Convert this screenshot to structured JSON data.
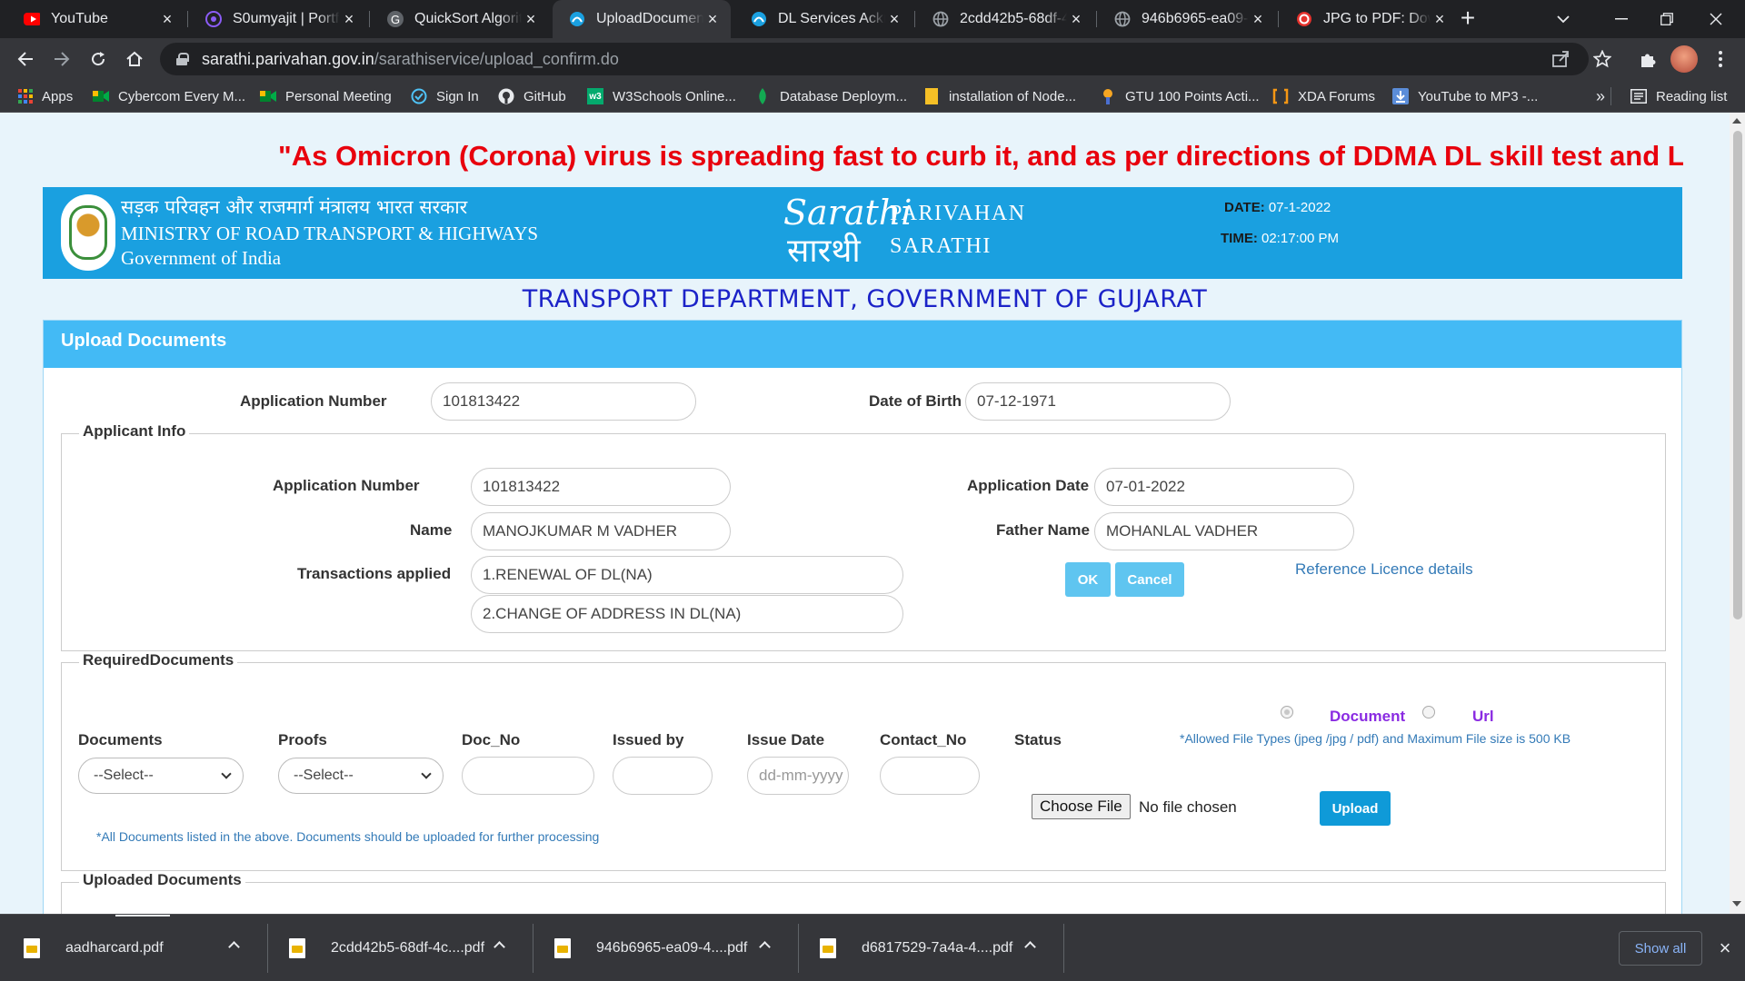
{
  "browser": {
    "tabs": [
      {
        "title": "YouTube",
        "icon": "youtube-icon",
        "color": "#ff0000"
      },
      {
        "title": "S0umyajit | Portfo",
        "icon": "portfolio-icon",
        "color": "#8b5cf6"
      },
      {
        "title": "QuickSort Algorit",
        "icon": "quicksort-icon",
        "color": "#5f6368"
      },
      {
        "title": "UploadDocument",
        "icon": "sarathi-icon",
        "color": "#1aa0e0"
      },
      {
        "title": "DL Services Ackn",
        "icon": "sarathi-icon",
        "color": "#1aa0e0"
      },
      {
        "title": "2cdd42b5-68df-4",
        "icon": "globe-icon",
        "color": "#9aa0a6"
      },
      {
        "title": "946b6965-ea09-4",
        "icon": "globe-icon",
        "color": "#9aa0a6"
      },
      {
        "title": "JPG to PDF: Down",
        "icon": "ilovepdf-icon",
        "color": "#e5322d"
      }
    ],
    "active_tab": 3,
    "url_host": "sarathi.parivahan.gov.in",
    "url_path": "/sarathiservice/upload_confirm.do",
    "bookmarks": [
      {
        "label": "Apps",
        "icon": "apps-grid-icon"
      },
      {
        "label": "Cybercom Every M...",
        "icon": "meet-icon"
      },
      {
        "label": "Personal Meeting",
        "icon": "meet-icon"
      },
      {
        "label": "Sign In",
        "icon": "signin-icon"
      },
      {
        "label": "GitHub",
        "icon": "github-icon"
      },
      {
        "label": "W3Schools Online...",
        "icon": "w3schools-icon"
      },
      {
        "label": "Database Deploym...",
        "icon": "mongodb-icon"
      },
      {
        "label": "installation of Node...",
        "icon": "bookmark-doc-icon"
      },
      {
        "label": "GTU 100 Points Acti...",
        "icon": "gtu-icon"
      },
      {
        "label": "XDA Forums",
        "icon": "xda-icon"
      },
      {
        "label": "YouTube to MP3 -...",
        "icon": "download-icon"
      }
    ],
    "overflow_chevron": "»",
    "reading_list": "Reading list"
  },
  "page": {
    "marquee": "\"As Omicron (Corona) virus is spreading fast to curb it, and as per directions of DDMA DL skill test and LL te",
    "banner": {
      "ministry_hindi": "सड़क परिवहन और राजमार्ग मंत्रालय भारत सरकार",
      "ministry_english": "MINISTRY OF ROAD TRANSPORT & HIGHWAYS",
      "government": "Government of India",
      "logo_line1": "Sarathi",
      "logo_line2": "सारथी",
      "brand_line1": "PARIVAHAN",
      "brand_line2": "SARATHI",
      "date_label": "DATE:",
      "date_value": "07-1-2022",
      "time_label": "TIME:",
      "time_value": "02:17:00 PM"
    },
    "department_title": "TRANSPORT DEPARTMENT, GOVERNMENT OF GUJARAT",
    "panel_title": "Upload Documents",
    "top_fields": {
      "application_number_label": "Application Number",
      "application_number": "101813422",
      "dob_label": "Date of Birth",
      "dob": "07-12-1971"
    },
    "applicant_info": {
      "legend": "Applicant Info",
      "application_number_label": "Application Number",
      "application_number": "101813422",
      "application_date_label": "Application Date",
      "application_date": "07-01-2022",
      "name_label": "Name",
      "name": "MANOJKUMAR M VADHER",
      "father_name_label": "Father Name",
      "father_name": "MOHANLAL  VADHER",
      "transactions_label": "Transactions applied",
      "transactions": [
        "1.RENEWAL OF DL(NA)",
        "2.CHANGE OF ADDRESS IN DL(NA)"
      ],
      "ok_label": "OK",
      "cancel_label": "Cancel",
      "reference_link": "Reference Licence details"
    },
    "required_documents": {
      "legend": "RequiredDocuments",
      "columns": [
        "Documents",
        "Proofs",
        "Doc_No",
        "Issued by",
        "Issue Date",
        "Contact_No",
        "Status"
      ],
      "documents_select": "--Select--",
      "proofs_select": "--Select--",
      "issue_date_placeholder": "dd-mm-yyyy",
      "radio_document": "Document",
      "radio_url": "Url",
      "allowed_note": "*Allowed File Types (jpeg /jpg / pdf) and Maximum File size is 500 KB",
      "choose_file": "Choose File",
      "no_file": "No file chosen",
      "upload_label": "Upload",
      "footer_note": "*All Documents listed in the above. Documents should be uploaded for further processing"
    },
    "uploaded_documents_legend": "Uploaded Documents"
  },
  "downloads": {
    "items": [
      "aadharcard.pdf",
      "2cdd42b5-68df-4c....pdf",
      "946b6965-ea09-4....pdf",
      "d6817529-7a4a-4....pdf"
    ],
    "show_all": "Show all"
  }
}
